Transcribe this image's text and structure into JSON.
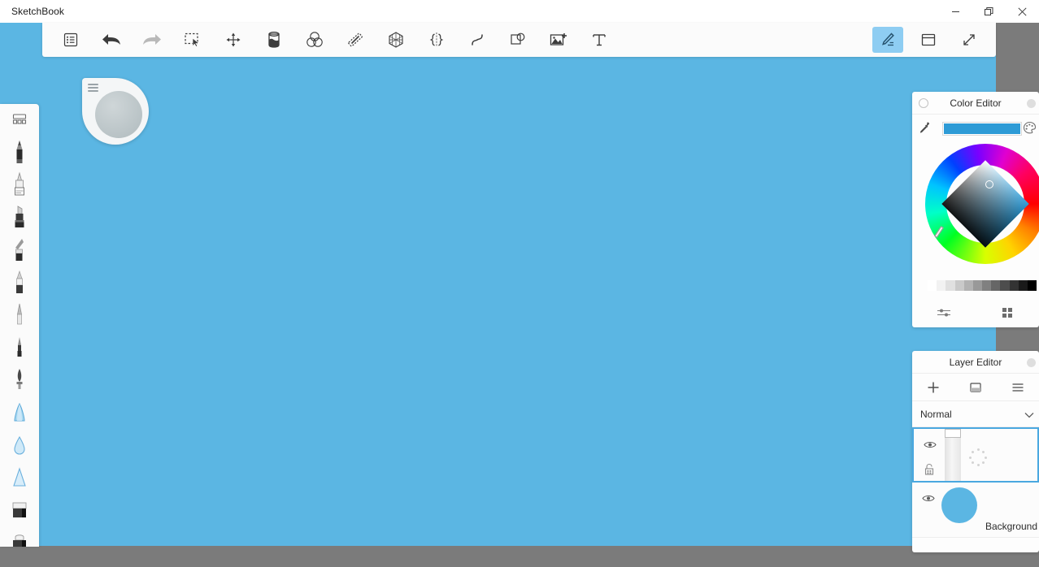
{
  "window": {
    "app_title": "SketchBook",
    "controls": [
      {
        "name": "minimize",
        "icon": "minimize-icon"
      },
      {
        "name": "restore",
        "icon": "restore-icon"
      },
      {
        "name": "close",
        "icon": "close-icon"
      }
    ]
  },
  "canvas": {
    "background_color": "#5bb6e3"
  },
  "toolbar": {
    "left_tools": [
      {
        "name": "menu",
        "icon": "list-menu-icon",
        "label": "Menu",
        "state": "enabled"
      },
      {
        "name": "undo",
        "icon": "undo-arrow-icon",
        "label": "Undo",
        "state": "enabled"
      },
      {
        "name": "redo",
        "icon": "redo-arrow-icon",
        "label": "Redo",
        "state": "disabled"
      },
      {
        "name": "select",
        "icon": "marquee-select-icon",
        "label": "Selection",
        "state": "enabled"
      },
      {
        "name": "transform",
        "icon": "move-arrows-icon",
        "label": "Transform",
        "state": "enabled"
      },
      {
        "name": "fill",
        "icon": "paint-bucket-icon",
        "label": "Fill",
        "state": "enabled"
      },
      {
        "name": "blend",
        "icon": "color-blend-circles-icon",
        "label": "Blending",
        "state": "enabled"
      },
      {
        "name": "ruler",
        "icon": "ruler-icon",
        "label": "Ruler",
        "state": "enabled"
      },
      {
        "name": "perspective",
        "icon": "perspective-grid-icon",
        "label": "Perspective Guide",
        "state": "enabled"
      },
      {
        "name": "symmetry",
        "icon": "symmetry-icon",
        "label": "Symmetry",
        "state": "enabled"
      },
      {
        "name": "french-curve",
        "icon": "french-curve-icon",
        "label": "French Curve",
        "state": "enabled"
      },
      {
        "name": "shapes",
        "icon": "shapes-overlap-icon",
        "label": "Shapes",
        "state": "enabled"
      },
      {
        "name": "add-image",
        "icon": "add-image-icon",
        "label": "Add Image",
        "state": "enabled"
      },
      {
        "name": "text",
        "icon": "text-tool-icon",
        "label": "Text",
        "state": "enabled"
      }
    ],
    "right_tools": [
      {
        "name": "brush-properties",
        "icon": "pen-brush-icon",
        "label": "Brush Properties",
        "state": "active"
      },
      {
        "name": "ui-layout",
        "icon": "window-panel-icon",
        "label": "UI Layout",
        "state": "enabled"
      },
      {
        "name": "fullscreen",
        "icon": "expand-diagonal-icon",
        "label": "Full Screen",
        "state": "enabled"
      }
    ]
  },
  "brush_palette": {
    "items": [
      {
        "name": "brush-library",
        "icon": "brush-library-icon",
        "label": "Brush Library"
      },
      {
        "name": "pencil",
        "icon": "pencil-tip-icon",
        "label": "Pencil"
      },
      {
        "name": "marker",
        "icon": "marker-tip-icon",
        "label": "Marker"
      },
      {
        "name": "chisel-marker",
        "icon": "chisel-marker-icon",
        "label": "Chisel Tip Marker"
      },
      {
        "name": "paintbrush",
        "icon": "paintbrush-icon",
        "label": "Paintbrush"
      },
      {
        "name": "flat-brush",
        "icon": "flat-brush-icon",
        "label": "Flat Brush"
      },
      {
        "name": "fine-pen",
        "icon": "fine-pen-icon",
        "label": "Fine Pen"
      },
      {
        "name": "ballpoint",
        "icon": "ballpoint-pen-icon",
        "label": "Ballpoint Pen"
      },
      {
        "name": "quill",
        "icon": "quill-nib-icon",
        "label": "Quill"
      },
      {
        "name": "soft-airbrush",
        "icon": "airbrush-cone-icon",
        "label": "Soft Airbrush"
      },
      {
        "name": "blender",
        "icon": "water-drop-icon",
        "label": "Blender"
      },
      {
        "name": "hard-airbrush",
        "icon": "airbrush-triangle-icon",
        "label": "Hard Airbrush"
      },
      {
        "name": "eraser-hard",
        "icon": "hard-eraser-icon",
        "label": "Hard Eraser"
      },
      {
        "name": "eraser-soft",
        "icon": "soft-eraser-icon",
        "label": "Soft Eraser"
      }
    ]
  },
  "brush_puck": {
    "name": "brush-puck",
    "menu_icon": "hamburger-lines-icon",
    "preview_color": "#bcc5c8"
  },
  "color_editor": {
    "title": "Color Editor",
    "collapse_icon": "circle-outline-icon",
    "close_icon": "dot-icon",
    "eyedropper_icon": "eyedropper-icon",
    "palette_icon": "color-palette-icon",
    "current_color": "#2e9bd6",
    "wheel": {
      "type": "hsb-wheel",
      "selected_color": "#2e9bd6",
      "hue_marker_angle": 200
    },
    "swatches": [
      "#ffffff",
      "#f2f2f2",
      "#e0e0e0",
      "#c9c9c9",
      "#b2b2b2",
      "#999999",
      "#808080",
      "#666666",
      "#4d4d4d",
      "#333333",
      "#1a1a1a",
      "#000000"
    ],
    "footer_tools": [
      {
        "name": "sliders",
        "icon": "sliders-icon",
        "label": "Sliders"
      },
      {
        "name": "swatch-grid",
        "icon": "grid-squares-icon",
        "label": "Swatches"
      }
    ]
  },
  "layer_editor": {
    "title": "Layer Editor",
    "close_icon": "dot-icon",
    "tools": [
      {
        "name": "add-layer",
        "icon": "plus-icon",
        "label": "Add Layer"
      },
      {
        "name": "duplicate-layer",
        "icon": "duplicate-layer-icon",
        "label": "Duplicate Layer"
      },
      {
        "name": "layer-menu",
        "icon": "hamburger-menu-icon",
        "label": "Layer Menu"
      }
    ],
    "blend_mode": {
      "value": "Normal",
      "chevron_icon": "chevron-down-icon"
    },
    "layers": [
      {
        "name": "layer-1",
        "label": "",
        "selected": true,
        "visible": true,
        "locked": false,
        "visibility_icon": "eye-icon",
        "lock_icon": "unlock-icon",
        "status_icon": "loading-spinner-icon"
      },
      {
        "name": "background-layer",
        "label": "Background",
        "selected": false,
        "visible": true,
        "visibility_icon": "eye-icon",
        "thumbnail_color": "#5bb6e3"
      }
    ]
  }
}
